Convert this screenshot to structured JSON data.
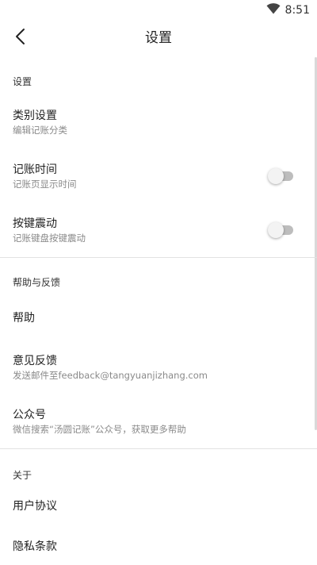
{
  "status_bar": {
    "time": "8:51",
    "icon": "wifi-icon"
  },
  "app_bar": {
    "title": "设置",
    "back_icon": "back-arrow-icon"
  },
  "sections": {
    "settings": {
      "header": "设置",
      "category": {
        "title": "类别设置",
        "subtitle": "编辑记账分类"
      },
      "record_time": {
        "title": "记账时间",
        "subtitle": "记账页显示时间",
        "enabled": false
      },
      "key_vibration": {
        "title": "按键震动",
        "subtitle": "记账键盘按键震动",
        "enabled": false
      }
    },
    "help": {
      "header": "帮助与反馈",
      "help_item": {
        "title": "帮助"
      },
      "feedback": {
        "title": "意见反馈",
        "subtitle": "发送邮件至feedback@tangyuanjizhang.com"
      },
      "official_account": {
        "title": "公众号",
        "subtitle": "微信搜索“汤圆记账”公众号，获取更多帮助"
      }
    },
    "about": {
      "header": "关于",
      "user_agreement": {
        "title": "用户协议"
      },
      "privacy": {
        "title": "隐私条款"
      }
    }
  },
  "colors": {
    "toggle_track_off": "#bdbdbd",
    "toggle_thumb_off": "#f3f3f3",
    "divider": "#e2e2e2"
  }
}
